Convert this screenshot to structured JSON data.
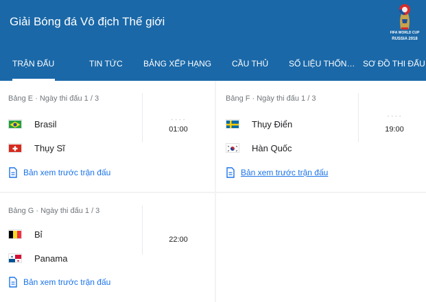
{
  "header": {
    "title": "Giải Bóng đá Vô địch Thế giới",
    "logo": {
      "icon": "fifa-world-cup-2018-logo-icon",
      "line1": "FIFA WORLD CUP",
      "line2": "RUSSIA 2018"
    },
    "background_color": "#1a68a8"
  },
  "tabs": [
    {
      "label": "TRẬN ĐẤU",
      "active": true
    },
    {
      "label": "TIN TỨC",
      "active": false
    },
    {
      "label": "BẢNG XẾP HẠNG",
      "active": false
    },
    {
      "label": "CẦU THỦ",
      "active": false
    },
    {
      "label": "SỐ LIỆU THỐN…",
      "active": false
    },
    {
      "label": "SƠ ĐỒ THI ĐẤU",
      "active": false
    }
  ],
  "matches": [
    {
      "meta": "Bảng E · Ngày thi đấu 1 / 3",
      "team1": {
        "name": "Brasil",
        "flag": "brazil-flag-icon"
      },
      "team2": {
        "name": "Thụy Sĩ",
        "flag": "switzerland-flag-icon"
      },
      "time": "01:00",
      "preview": "Bản xem trước trận đấu"
    },
    {
      "meta": "Bảng F · Ngày thi đấu 1 / 3",
      "team1": {
        "name": "Thụy Điển",
        "flag": "sweden-flag-icon"
      },
      "team2": {
        "name": "Hàn Quốc",
        "flag": "south-korea-flag-icon"
      },
      "time": "19:00",
      "preview": "Bản xem trước trận đấu"
    },
    {
      "meta": "Bảng G · Ngày thi đấu 1 / 3",
      "team1": {
        "name": "Bỉ",
        "flag": "belgium-flag-icon"
      },
      "team2": {
        "name": "Panama",
        "flag": "panama-flag-icon"
      },
      "time": "22:00",
      "preview": "Bản xem trước trận đấu"
    }
  ],
  "colors": {
    "link": "#1a73e8",
    "meta": "#70757a"
  }
}
